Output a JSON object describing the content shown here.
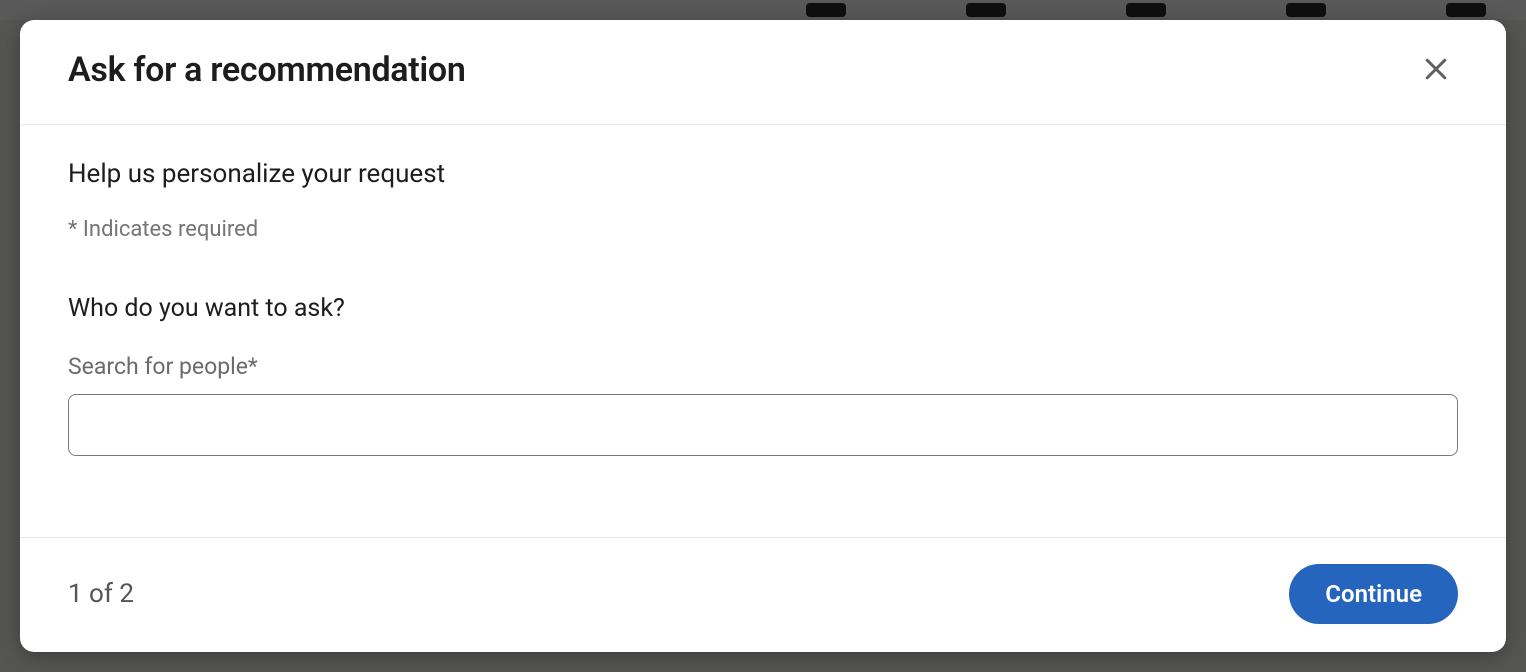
{
  "modal": {
    "title": "Ask for a recommendation",
    "subtitle": "Help us personalize your request",
    "required_note": "* Indicates required",
    "question": "Who do you want to ask?",
    "field_label": "Search for people*",
    "search_value": "",
    "step_indicator": "1 of 2",
    "continue_label": "Continue"
  }
}
